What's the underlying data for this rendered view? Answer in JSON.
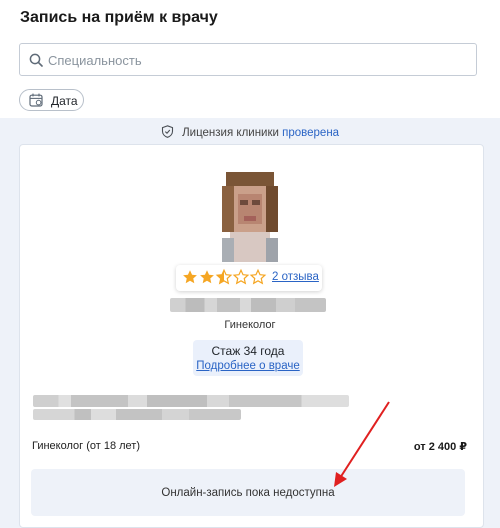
{
  "header": {
    "title": "Запись на приём к врачу",
    "search_placeholder": "Специальность",
    "date_filter_label": "Дата"
  },
  "license": {
    "text": "Лицензия клиники",
    "link": "проверена"
  },
  "doctor": {
    "rating_stars": 2.5,
    "rating_max": 5,
    "star_color": "#f5a623",
    "reviews_link": "2 отзыва",
    "specialty": "Гинеколог",
    "experience": "Стаж 34 года",
    "more_link": "Подробнее о враче",
    "service_name": "Гинеколог (от 18 лет)",
    "service_price": "от 2 400 ₽",
    "status_message": "Онлайн-запись пока недоступна"
  },
  "icons": {
    "search": "search-icon",
    "calendar": "calendar-icon",
    "shield": "shield-check-icon",
    "star": "star-icon"
  },
  "colors": {
    "link": "#2a64c5",
    "annotation_arrow": "#e02020"
  }
}
